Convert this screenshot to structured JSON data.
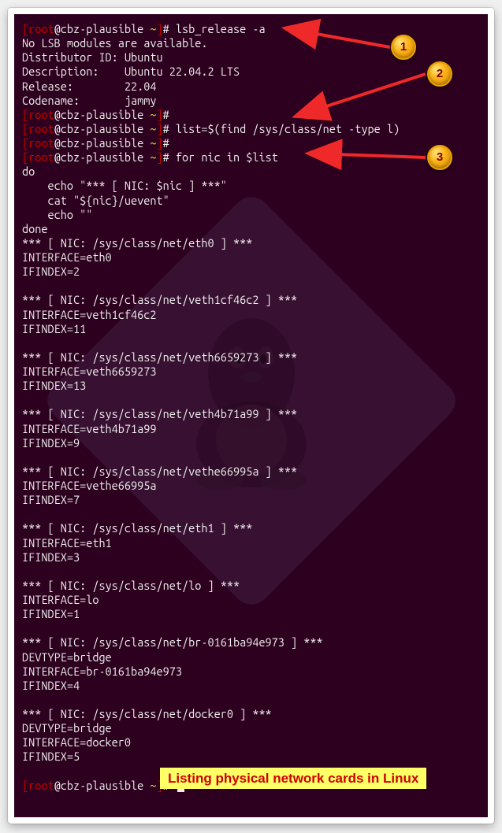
{
  "prompt": {
    "user": "root",
    "host": "cbz-plausible",
    "path": "~",
    "suffix": "#"
  },
  "commands": {
    "cmd1": "lsb_release -a",
    "cmd2": "list=$(find /sys/class/net -type l)",
    "cmd3": "for nic in $list"
  },
  "lsb": {
    "no_modules": "No LSB modules are available.",
    "distributor_label": "Distributor ID:",
    "distributor_value": "Ubuntu",
    "description_label": "Description:",
    "description_value": "Ubuntu 22.04.2 LTS",
    "release_label": "Release:",
    "release_value": "22.04",
    "codename_label": "Codename:",
    "codename_value": "jammy"
  },
  "loop": {
    "do": "do",
    "line1": "    echo \"*** [ NIC: $nic ] ***\"",
    "line2": "    cat \"${nic}/uevent\"",
    "line3": "    echo \"\"",
    "done": "done"
  },
  "nics": [
    {
      "path": "/sys/class/net/eth0",
      "lines": [
        "INTERFACE=eth0",
        "IFINDEX=2"
      ]
    },
    {
      "path": "/sys/class/net/veth1cf46c2",
      "lines": [
        "INTERFACE=veth1cf46c2",
        "IFINDEX=11"
      ]
    },
    {
      "path": "/sys/class/net/veth6659273",
      "lines": [
        "INTERFACE=veth6659273",
        "IFINDEX=13"
      ]
    },
    {
      "path": "/sys/class/net/veth4b71a99",
      "lines": [
        "INTERFACE=veth4b71a99",
        "IFINDEX=9"
      ]
    },
    {
      "path": "/sys/class/net/vethe66995a",
      "lines": [
        "INTERFACE=vethe66995a",
        "IFINDEX=7"
      ]
    },
    {
      "path": "/sys/class/net/eth1",
      "lines": [
        "INTERFACE=eth1",
        "IFINDEX=3"
      ]
    },
    {
      "path": "/sys/class/net/lo",
      "lines": [
        "INTERFACE=lo",
        "IFINDEX=1"
      ]
    },
    {
      "path": "/sys/class/net/br-0161ba94e973",
      "lines": [
        "DEVTYPE=bridge",
        "INTERFACE=br-0161ba94e973",
        "IFINDEX=4"
      ]
    },
    {
      "path": "/sys/class/net/docker0",
      "lines": [
        "DEVTYPE=bridge",
        "INTERFACE=docker0",
        "IFINDEX=5"
      ]
    }
  ],
  "annotations": {
    "badge1": "1",
    "badge2": "2",
    "badge3": "3",
    "caption": "Listing physical network cards in Linux"
  },
  "colors": {
    "bg": "#2c001e",
    "text": "#eeeeec",
    "red": "#cc0000",
    "yellow": "#fce94f",
    "highlight_bg": "#ffff66",
    "arrow": "#ef2929",
    "badge_fill": "#fcb418",
    "badge_text": "#7a0000"
  }
}
